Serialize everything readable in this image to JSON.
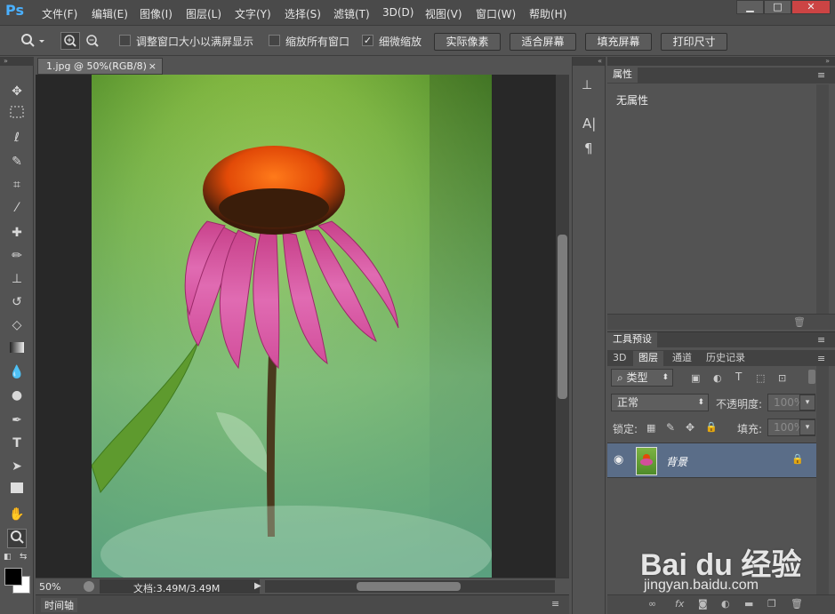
{
  "app": {
    "logo": "Ps"
  },
  "menu": [
    {
      "label": "文件(F)"
    },
    {
      "label": "编辑(E)"
    },
    {
      "label": "图像(I)"
    },
    {
      "label": "图层(L)"
    },
    {
      "label": "文字(Y)"
    },
    {
      "label": "选择(S)"
    },
    {
      "label": "滤镜(T)"
    },
    {
      "label": "3D(D)"
    },
    {
      "label": "视图(V)"
    },
    {
      "label": "窗口(W)"
    },
    {
      "label": "帮助(H)"
    }
  ],
  "window_controls": {
    "minimize": "▁",
    "maximize": "□",
    "close": "✕"
  },
  "options": {
    "check1_label": "调整窗口大小以满屏显示",
    "check2_label": "缩放所有窗口",
    "check3_label": "细微缩放",
    "check3_mark": "✓",
    "btn_actual": "实际像素",
    "btn_fit": "适合屏幕",
    "btn_fill": "填充屏幕",
    "btn_print": "打印尺寸"
  },
  "document": {
    "tab_title": "1.jpg @ 50%(RGB/8)",
    "tab_close": "×"
  },
  "status": {
    "zoom": "50%",
    "doc_info": "文档:3.49M/3.49M"
  },
  "timeline": {
    "label": "时间轴"
  },
  "properties": {
    "tab": "属性",
    "content": "无属性"
  },
  "tool_presets": {
    "tab": "工具预设"
  },
  "layers_panel": {
    "tabs": [
      {
        "label": "3D"
      },
      {
        "label": "图层"
      },
      {
        "label": "通道"
      },
      {
        "label": "历史记录"
      }
    ],
    "filter_kind": "类型",
    "blend_mode": "正常",
    "opacity_label": "不透明度:",
    "opacity_value": "100%",
    "lock_label": "锁定:",
    "fill_label": "填充:",
    "fill_value": "100%",
    "layers": [
      {
        "name": "背景"
      }
    ]
  },
  "watermark": {
    "brand": "Bai du 经验",
    "url": "jingyan.baidu.com"
  },
  "colors": {
    "accent": "#4ab0ff",
    "selected_layer": "#5a6d88",
    "canvas_bg": "#282828"
  },
  "icons": {
    "tools": [
      "move-icon",
      "marquee-icon",
      "lasso-icon",
      "quick-select-icon",
      "crop-icon",
      "eyedropper-icon",
      "healing-icon",
      "brush-icon",
      "stamp-icon",
      "history-brush-icon",
      "eraser-icon",
      "gradient-icon",
      "blur-icon",
      "dodge-icon",
      "pen-icon",
      "type-icon",
      "path-select-icon",
      "rectangle-icon",
      "hand-icon",
      "zoom-icon"
    ]
  }
}
